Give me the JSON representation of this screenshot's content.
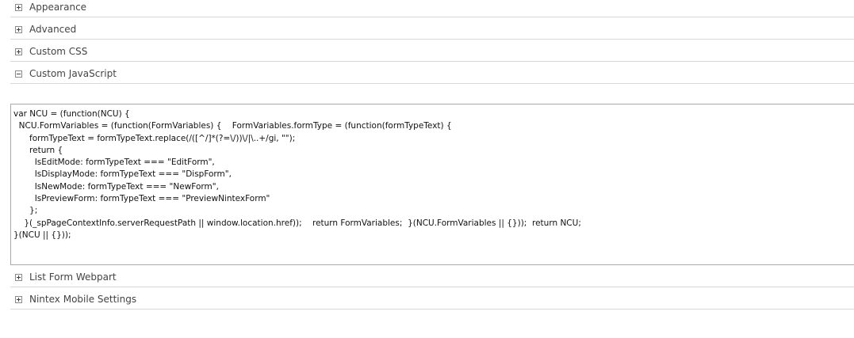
{
  "sections_top": [
    {
      "label": "Appearance",
      "state": "collapsed"
    },
    {
      "label": "Advanced",
      "state": "collapsed"
    },
    {
      "label": "Custom CSS",
      "state": "collapsed"
    },
    {
      "label": "Custom JavaScript",
      "state": "expanded"
    }
  ],
  "custom_javascript": {
    "code": "var NCU = (function(NCU) {\n  NCU.FormVariables = (function(FormVariables) {    FormVariables.formType = (function(formTypeText) {\n      formTypeText = formTypeText.replace(/([^/]*(?=\\/))\\/|\\..+/gi, \"\");\n      return {\n        IsEditMode: formTypeText === \"EditForm\",\n        IsDisplayMode: formTypeText === \"DispForm\",\n        IsNewMode: formTypeText === \"NewForm\",\n        IsPreviewForm: formTypeText === \"PreviewNintexForm\"\n      };\n    }(_spPageContextInfo.serverRequestPath || window.location.href));    return FormVariables;  }(NCU.FormVariables || {}));  return NCU;\n}(NCU || {}));"
  },
  "sections_bottom": [
    {
      "label": "List Form Webpart",
      "state": "collapsed"
    },
    {
      "label": "Nintex Mobile Settings",
      "state": "collapsed"
    }
  ],
  "icons": {
    "collapsed": "plus-icon",
    "expanded": "minus-icon"
  }
}
